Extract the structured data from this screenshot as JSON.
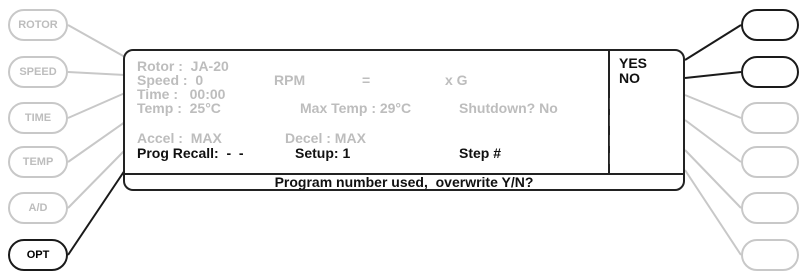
{
  "left_softkeys": [
    {
      "label": "ROTOR",
      "active": false
    },
    {
      "label": "SPEED",
      "active": false
    },
    {
      "label": "TIME",
      "active": false
    },
    {
      "label": "TEMP",
      "active": false
    },
    {
      "label": "A/D",
      "active": false
    },
    {
      "label": "OPT",
      "active": true
    }
  ],
  "right_softkeys": [
    {
      "label": "",
      "active": true
    },
    {
      "label": "",
      "active": true
    },
    {
      "label": "",
      "active": false
    },
    {
      "label": "",
      "active": false
    },
    {
      "label": "",
      "active": false
    },
    {
      "label": "",
      "active": false
    }
  ],
  "display": {
    "rotor": "Rotor :  JA-20",
    "speed": "Speed :  0",
    "rpm": "RPM",
    "equals": "=",
    "xg": "x G",
    "time": "Time :   00:00",
    "temp": "Temp :  25°C",
    "max_temp": "Max Temp : 29°C",
    "shutdown": "Shutdown? No",
    "accel": "Accel :  MAX",
    "decel": "Decel : MAX",
    "prog_recall": "Prog Recall:  -  -",
    "setup": "Setup: 1",
    "step": "Step #",
    "option_yes": "YES",
    "option_no": "NO",
    "message": "Program number used,  overwrite Y/N?"
  },
  "colors": {
    "dim": "#c8c8c8",
    "active": "#1a1a1a"
  }
}
